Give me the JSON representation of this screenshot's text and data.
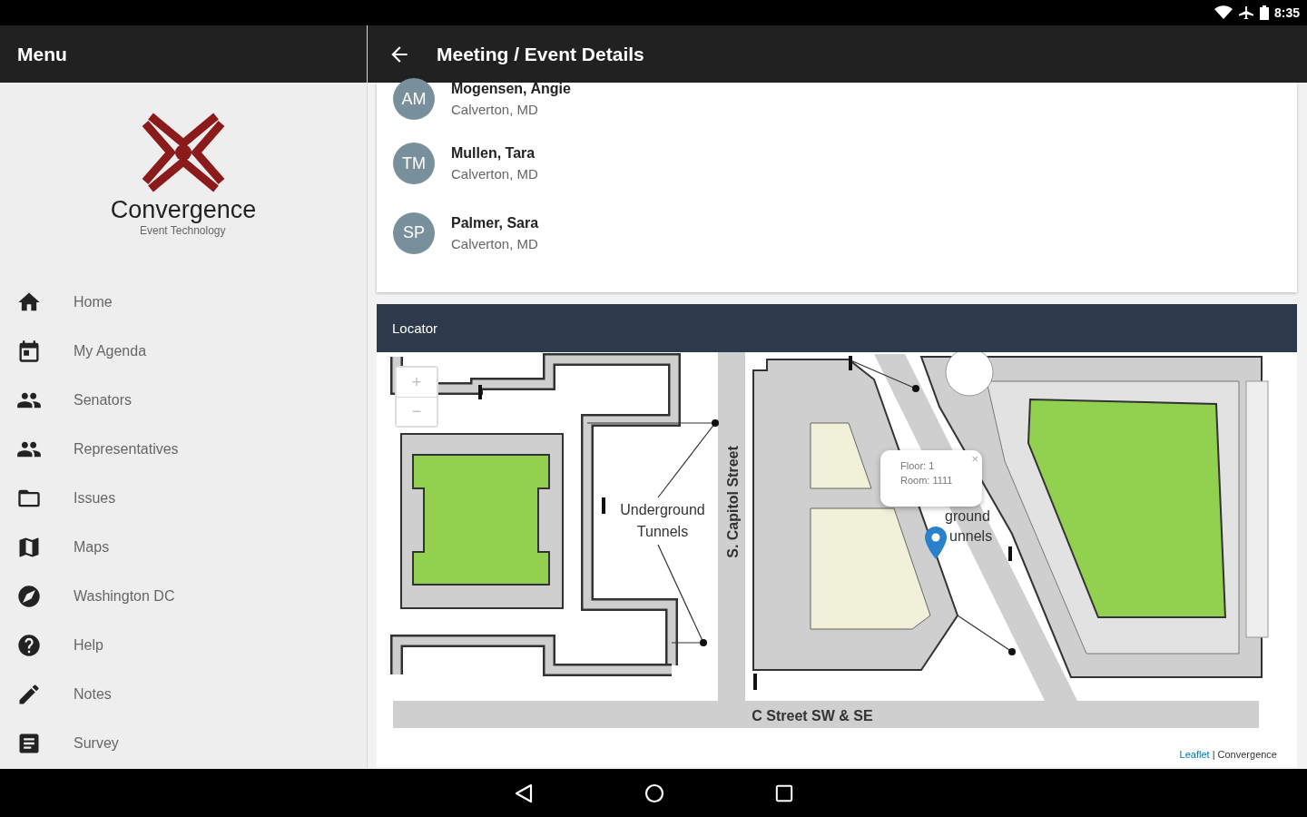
{
  "status_bar": {
    "time": "8:35"
  },
  "sidebar": {
    "title": "Menu",
    "logo": {
      "name": "Convergence",
      "tagline": "Event Technology"
    },
    "items": [
      {
        "label": "Home"
      },
      {
        "label": "My Agenda"
      },
      {
        "label": "Senators"
      },
      {
        "label": "Representatives"
      },
      {
        "label": "Issues"
      },
      {
        "label": "Maps"
      },
      {
        "label": "Washington DC"
      },
      {
        "label": "Help"
      },
      {
        "label": "Notes"
      },
      {
        "label": "Survey"
      }
    ]
  },
  "header": {
    "title": "Meeting / Event Details"
  },
  "attendees": [
    {
      "initials": "AM",
      "name": "Mogensen, Angie",
      "location": "Calverton, MD"
    },
    {
      "initials": "TM",
      "name": "Mullen, Tara",
      "location": "Calverton, MD"
    },
    {
      "initials": "SP",
      "name": "Palmer, Sara",
      "location": "Calverton, MD"
    }
  ],
  "locator": {
    "title": "Locator",
    "zoom_in": "+",
    "zoom_out": "−",
    "labels": [
      {
        "text": "Underground Tunnels"
      },
      {
        "text": "S. Capitol Street"
      },
      {
        "text": "C Street SW & SE"
      },
      {
        "text": "ground"
      },
      {
        "text": "unnels"
      }
    ],
    "popup": {
      "lines": [
        "Floor: 1",
        "Room: 1111"
      ],
      "close": "×"
    },
    "attribution": {
      "link": "Leaflet",
      "text": "| Convergence"
    }
  }
}
